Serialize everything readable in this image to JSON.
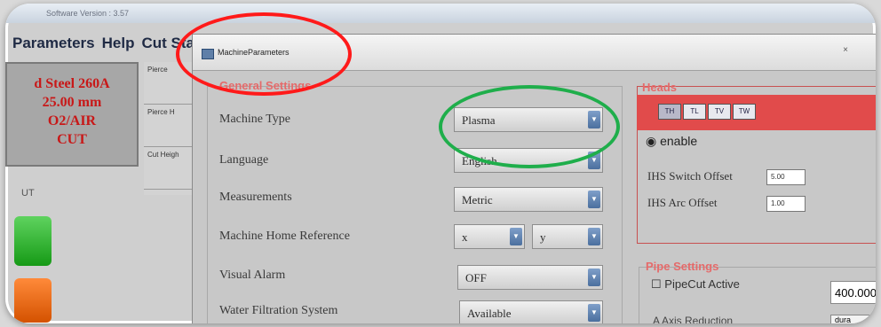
{
  "background_app": {
    "title": "Software Version : 3.57",
    "menu": [
      "Parameters",
      "Help",
      "Cut Sta"
    ],
    "material_lines": [
      "d Steel 260A",
      "25.00 mm",
      "O2/AIR",
      "CUT"
    ],
    "column_tabs": [
      "Pierce",
      "Pierce H",
      "Cut Heigh"
    ],
    "label_ut": "UT"
  },
  "dialog": {
    "title": "MachineParameters",
    "general_settings": {
      "title": "General Settings",
      "rows": [
        {
          "label": "Machine Type",
          "value": "Plasma"
        },
        {
          "label": "Language",
          "value": "English"
        },
        {
          "label": "Measurements",
          "value": "Metric"
        },
        {
          "label": "Machine Home Reference",
          "value_x": "x",
          "value_y": "y"
        },
        {
          "label": "Visual Alarm",
          "value": "OFF"
        },
        {
          "label": "Water Filtration System",
          "value": "Available"
        }
      ]
    },
    "heads": {
      "title": "Heads",
      "buttons": [
        "TH",
        "TL",
        "TV",
        "TW"
      ],
      "enable_label": "enable",
      "ihs_switch_offset_label": "IHS Switch Offset",
      "ihs_switch_offset_value": "5.00",
      "ihs_arc_offset_label": "IHS Arc Offset",
      "ihs_arc_offset_value": "1.00"
    },
    "pipe_settings": {
      "title": "Pipe Settings",
      "pipecut_label": "PipeCut Active",
      "pipe_value": "400.000",
      "axis_label": "A Axis Reduction",
      "axis_value": "dura"
    }
  },
  "colors": {
    "annotation_red": "#ff1a1a",
    "annotation_green": "#1fae4b",
    "heads_bar": "#e14b4b"
  }
}
